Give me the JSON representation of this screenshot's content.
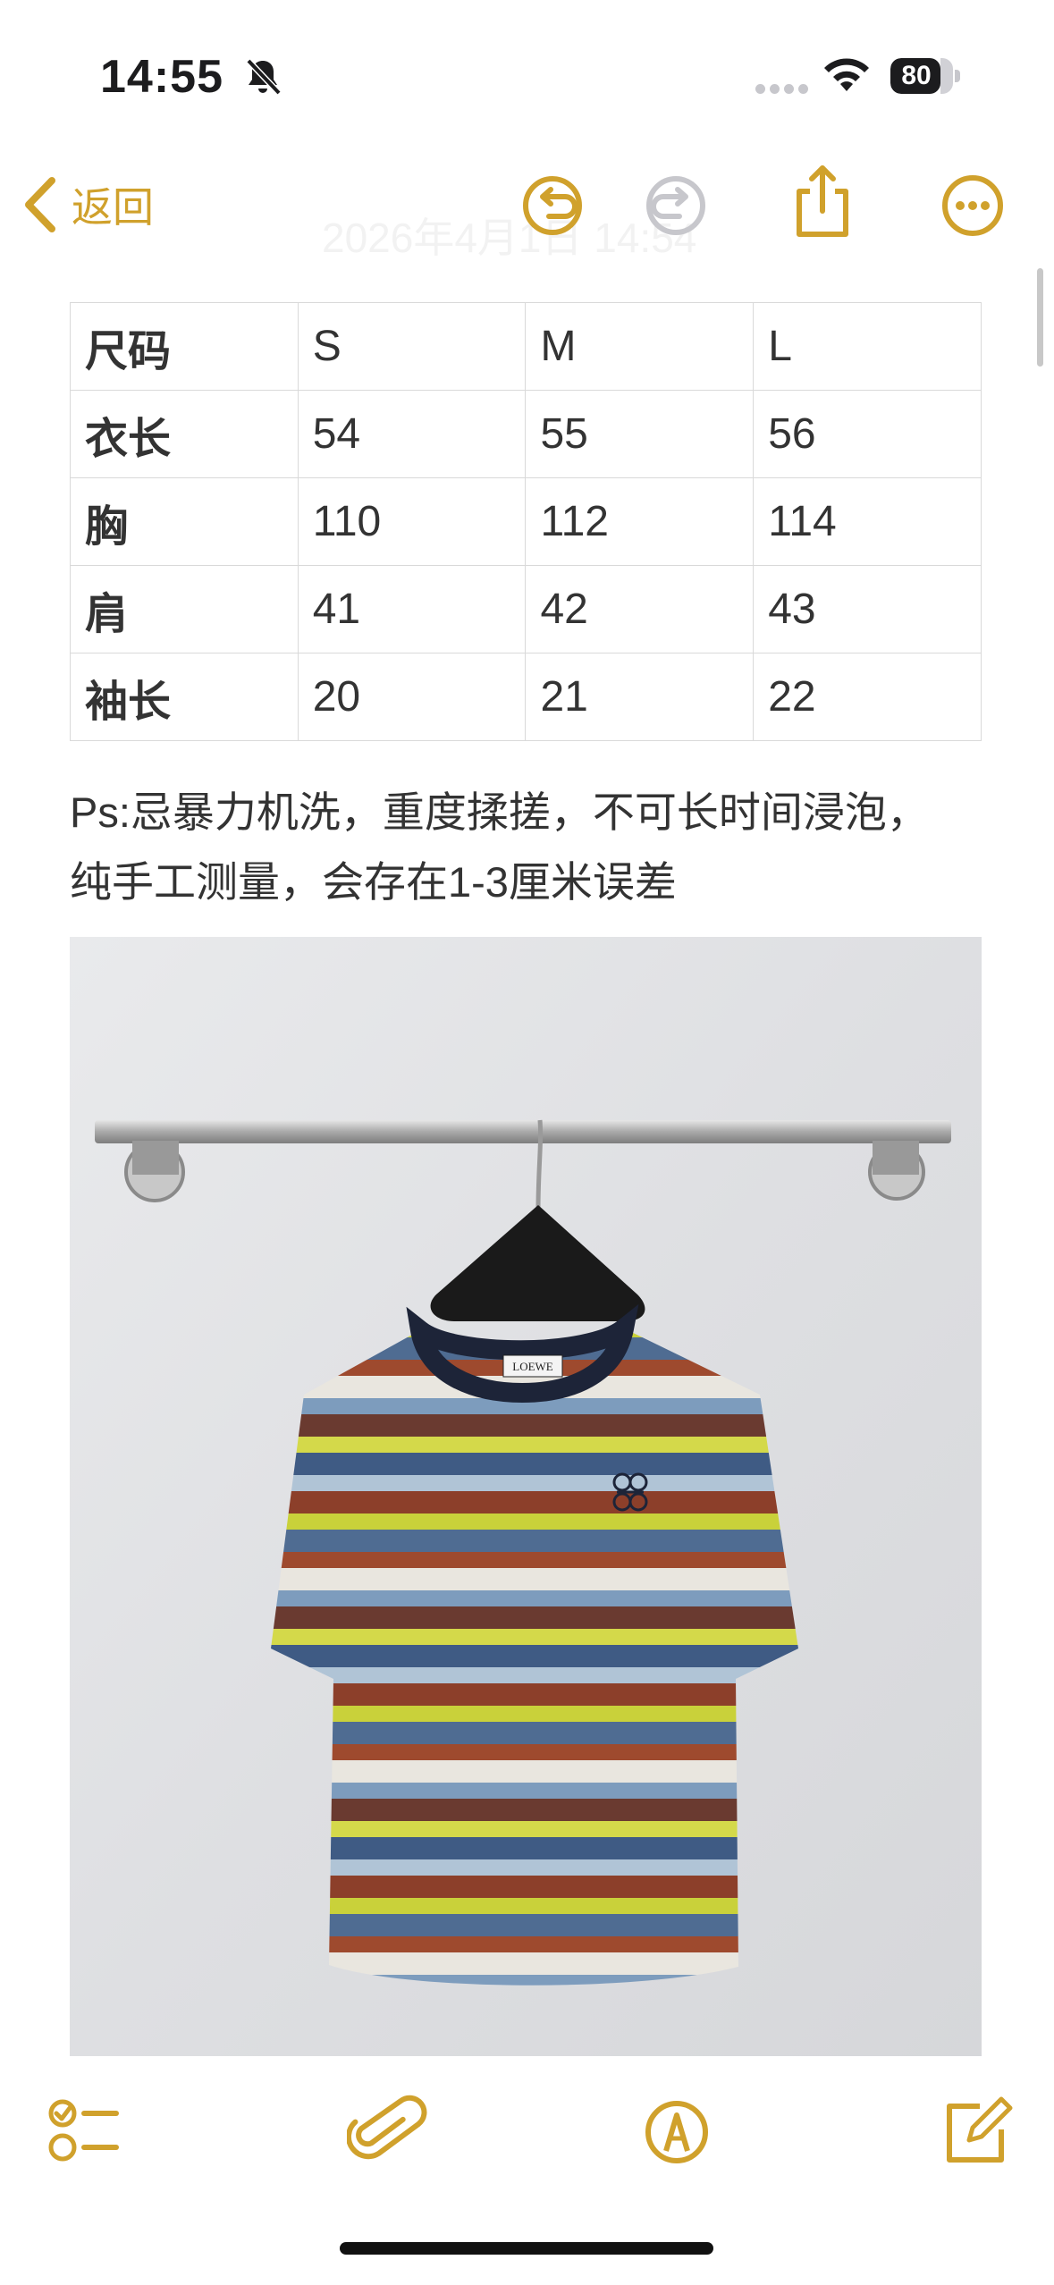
{
  "status_bar": {
    "time": "14:55",
    "battery": "80",
    "battery_level": 0.8
  },
  "nav": {
    "back_label": "返回",
    "faded_date": "2026年4月1日 14:54"
  },
  "size_table": {
    "rows": [
      [
        "尺码",
        "S",
        "M",
        "L"
      ],
      [
        "衣长",
        "54",
        "55",
        "56"
      ],
      [
        "胸",
        "110",
        "112",
        "114"
      ],
      [
        "肩",
        "41",
        "42",
        "43"
      ],
      [
        "袖长",
        "20",
        "21",
        "22"
      ]
    ]
  },
  "note": {
    "line1": "Ps:忌暴力机洗，重度揉搓，不可长时间浸泡，",
    "line2": "纯手工测量，会存在1-3厘米误差"
  },
  "photo": {
    "label_text": "LOEWE"
  },
  "colors": {
    "accent": "#d0a12c"
  },
  "icons": {
    "nav": [
      "chevron-left-icon",
      "undo-icon",
      "redo-icon",
      "share-icon",
      "more-icon"
    ],
    "toolbar": [
      "checklist-icon",
      "paperclip-icon",
      "markup-icon",
      "compose-icon"
    ]
  }
}
